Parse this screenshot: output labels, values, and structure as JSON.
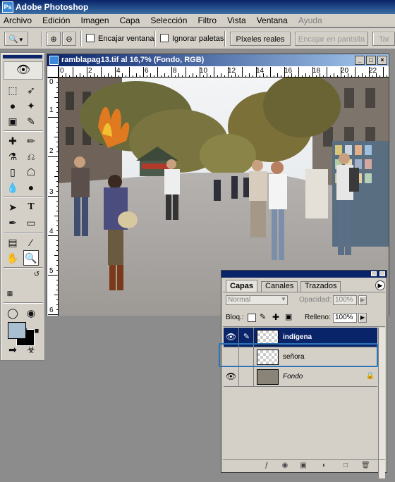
{
  "app": {
    "title": "Adobe Photoshop"
  },
  "menu": [
    "Archivo",
    "Edición",
    "Imagen",
    "Capa",
    "Selección",
    "Filtro",
    "Vista",
    "Ventana",
    "Ayuda"
  ],
  "options_bar": {
    "fit_window_label": "Encajar ventana",
    "ignore_palettes_label": "Ignorar paletas",
    "actual_pixels_button": "Píxeles reales",
    "fit_screen_button": "Encajar en pantalla",
    "print_size_button": "Tar"
  },
  "document": {
    "title": "ramblapag13.tif al 16,7% (Fondo, RGB)",
    "ruler_top": [
      "0",
      "2",
      "4",
      "6",
      "8",
      "10",
      "12",
      "14",
      "16",
      "18",
      "20",
      "22"
    ],
    "ruler_left": [
      "0",
      "1",
      "2",
      "3",
      "4",
      "5",
      "6"
    ],
    "ruler_top_tab": "01"
  },
  "layers_panel": {
    "tabs": [
      "Capas",
      "Canales",
      "Trazados"
    ],
    "blend_mode": "Normal",
    "opacity_label": "Opacidad:",
    "opacity_value": "100%",
    "lock_label": "Bloq.:",
    "fill_label": "Relleno:",
    "fill_value": "100%",
    "layers": [
      {
        "name": "indígena",
        "visible": true,
        "selected": true
      },
      {
        "name": "señora",
        "visible": false,
        "selected": false
      },
      {
        "name": "Fondo",
        "visible": true,
        "selected": false,
        "locked": true
      }
    ]
  },
  "colors": {
    "foreground": "#a7bfd0",
    "background": "#000000",
    "accent": "#0a246a",
    "highlight_frame": "#2d74b8"
  }
}
